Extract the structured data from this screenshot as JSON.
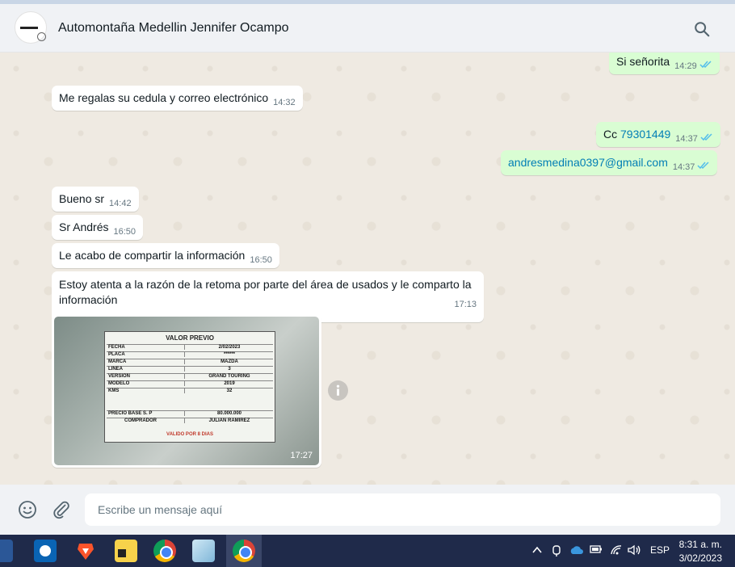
{
  "header": {
    "title": "Automontaña Medellin Jennifer Ocampo",
    "avatar_icon": "car-dealer-logo-icon",
    "search_icon": "search-icon"
  },
  "messages": [
    {
      "dir": "out",
      "text": "Si señorita",
      "time": "14:29",
      "status": "read"
    },
    {
      "dir": "in",
      "text": "Me regalas su cedula y correo electrónico",
      "time": "14:32"
    },
    {
      "dir": "out",
      "prefix": "Cc ",
      "link": "79301449",
      "time": "14:37",
      "status": "read"
    },
    {
      "dir": "out",
      "link": "andresmedina0397@gmail.com",
      "time": "14:37",
      "status": "read"
    },
    {
      "dir": "in",
      "text": "Bueno sr",
      "time": "14:42"
    },
    {
      "dir": "in",
      "text": "Sr Andrés",
      "time": "16:50"
    },
    {
      "dir": "in",
      "text": "Le acabo de compartir la información",
      "time": "16:50"
    },
    {
      "dir": "in",
      "text": "Estoy atenta a la razón de la retoma por parte del área de usados y le comparto la información",
      "time": "17:13"
    },
    {
      "dir": "in",
      "type": "image",
      "time": "17:27"
    }
  ],
  "photo_sheet": {
    "title": "VALOR PREVIO",
    "rows": [
      {
        "k": "FECHA",
        "v": "2/02/2023"
      },
      {
        "k": "PLACA",
        "v": "******"
      },
      {
        "k": "MARCA",
        "v": "MAZDA"
      },
      {
        "k": "LINEA",
        "v": "3"
      },
      {
        "k": "VERSION",
        "v": "GRAND TOURING"
      },
      {
        "k": "MODELO",
        "v": "2019"
      },
      {
        "k": "KMS",
        "v": "32"
      },
      {
        "k": "PRECIO BASE  S. P",
        "v": "80.000.000"
      },
      {
        "k": "COMPRADOR",
        "v": "JULIAN RAMIREZ"
      }
    ],
    "valid": "VALIDO POR 8 DIAS"
  },
  "compose": {
    "placeholder": "Escribe un mensaje aquí",
    "emoji_icon": "emoji-icon",
    "attach_icon": "paperclip-icon"
  },
  "taskbar": {
    "apps": [
      "word-icon",
      "outlook-icon",
      "brave-icon",
      "sticky-notes-icon",
      "chrome-icon",
      "notepad-icon",
      "chrome-profile-icon"
    ],
    "language": "ESP",
    "time": "8:31 a. m.",
    "date": "3/02/2023"
  },
  "colors": {
    "incoming": "#ffffff",
    "outgoing": "#d9fdd3",
    "link": "#027eb5",
    "read_ticks": "#53bdeb",
    "taskbar": "#1f2a4a"
  }
}
